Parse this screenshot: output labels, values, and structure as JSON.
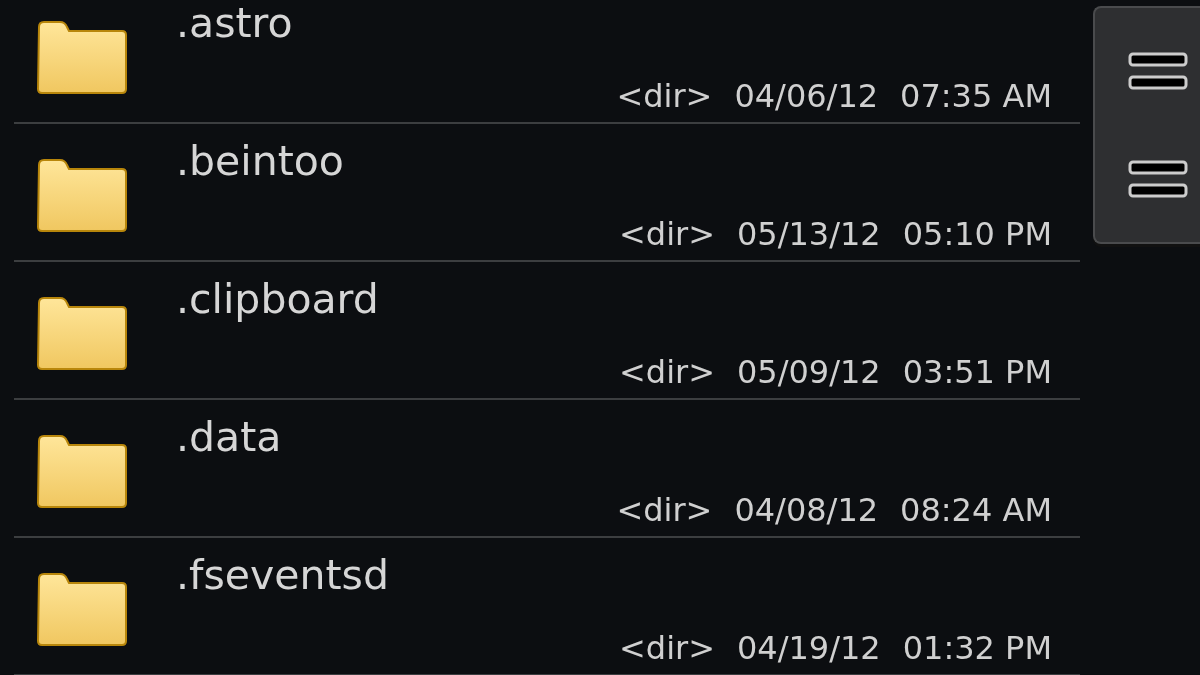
{
  "files": [
    {
      "name": ".astro",
      "type": "<dir>",
      "date": "04/06/12",
      "time": "07:35 AM"
    },
    {
      "name": ".beintoo",
      "type": "<dir>",
      "date": "05/13/12",
      "time": "05:10 PM"
    },
    {
      "name": ".clipboard",
      "type": "<dir>",
      "date": "05/09/12",
      "time": "03:51 PM"
    },
    {
      "name": ".data",
      "type": "<dir>",
      "date": "04/08/12",
      "time": "08:24 AM"
    },
    {
      "name": ".fseventsd",
      "type": "<dir>",
      "date": "04/19/12",
      "time": "01:32 PM"
    }
  ]
}
